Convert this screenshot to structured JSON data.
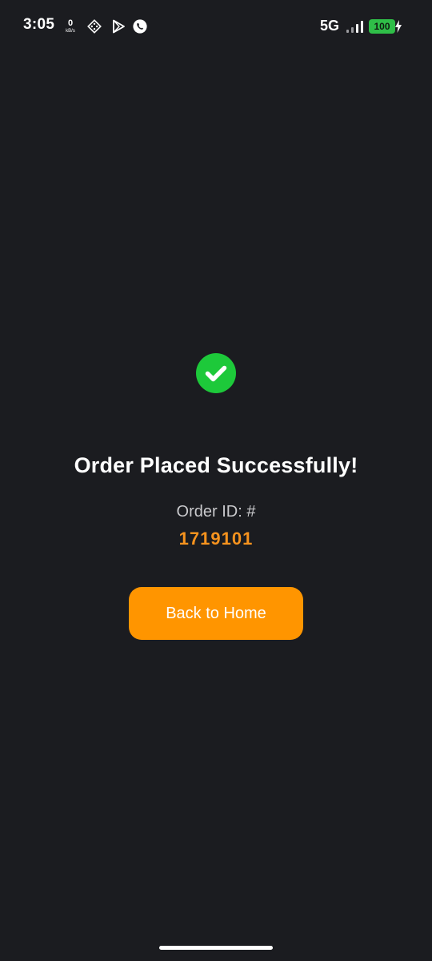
{
  "status_bar": {
    "time": "3:05",
    "net_speed_value": "0",
    "net_speed_unit": "kB/s",
    "network_type": "5G",
    "battery_level": "100",
    "icons": [
      "network-speed-icon",
      "app-grid-icon",
      "play-store-icon",
      "whatsapp-icon",
      "signal-icon",
      "battery-icon",
      "charging-icon"
    ]
  },
  "confirmation": {
    "icon": "check-circle-icon",
    "icon_color": "#1dc93a",
    "title": "Order Placed Successfully!",
    "order_id_label": "Order ID: #",
    "order_id": "1719101",
    "order_id_color": "#f7931e"
  },
  "actions": {
    "back_home_label": "Back to Home",
    "button_color": "#ff9500"
  },
  "theme": {
    "background": "#1b1c20"
  }
}
